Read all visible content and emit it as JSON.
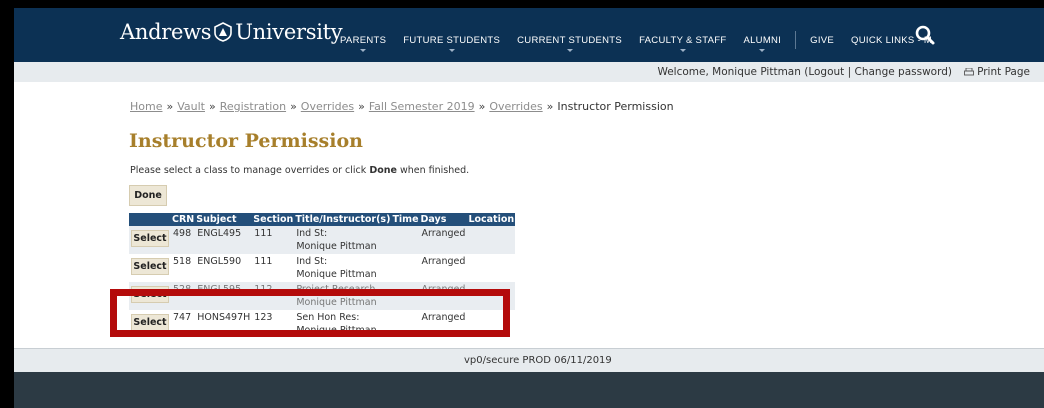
{
  "header": {
    "logo_left": "Andrews",
    "logo_right": "University",
    "nav": [
      {
        "label": "PARENTS",
        "caret": true
      },
      {
        "label": "FUTURE STUDENTS",
        "caret": true
      },
      {
        "label": "CURRENT STUDENTS",
        "caret": true
      },
      {
        "label": "FACULTY & STAFF",
        "caret": true
      },
      {
        "label": "ALUMNI",
        "caret": true
      },
      {
        "label": "GIVE",
        "caret": false
      },
      {
        "label": "QUICK LINKS - M",
        "caret": false
      }
    ],
    "search_icon": "search-icon",
    "colors": {
      "nav_bg": "#0c3154",
      "accent": "#a77f2b"
    }
  },
  "subbar": {
    "welcome_prefix": "Welcome, Monique Pittman (",
    "logout": "Logout",
    "divider": " | ",
    "change_password": "Change password",
    "welcome_suffix": ")",
    "print_page": "Print Page"
  },
  "breadcrumb": {
    "links": [
      "Home",
      "Vault",
      "Registration",
      "Overrides",
      "Fall Semester 2019",
      "Overrides"
    ],
    "separator": "»",
    "current": "Instructor Permission"
  },
  "page": {
    "title": "Instructor Permission",
    "instructions_before": "Please select a class to manage overrides or click ",
    "instructions_bold": "Done",
    "instructions_after": " when finished.",
    "done_label": "Done"
  },
  "table": {
    "headers": [
      "",
      "CRN",
      "Subject",
      "Section",
      "Title/Instructor(s)",
      "Time",
      "Days",
      "Location"
    ],
    "select_label": "Select",
    "rows": [
      {
        "crn": "498",
        "subject": "ENGL495",
        "section": "111",
        "title": "Ind St:",
        "instructor": "Monique Pittman",
        "time": "",
        "days": "Arranged",
        "location": ""
      },
      {
        "crn": "518",
        "subject": "ENGL590",
        "section": "111",
        "title": "Ind St:",
        "instructor": "Monique Pittman",
        "time": "",
        "days": "Arranged",
        "location": ""
      },
      {
        "crn": "528",
        "subject": "ENGL595",
        "section": "112",
        "title": "Project Research",
        "instructor": "Monique Pittman",
        "time": "",
        "days": "Arranged",
        "location": ""
      },
      {
        "crn": "747",
        "subject": "HONS497H",
        "section": "123",
        "title": "Sen Hon Res:",
        "instructor": "Monique Pittman",
        "time": "",
        "days": "Arranged",
        "location": ""
      }
    ]
  },
  "footer": {
    "text": "vp0/secure PROD 06/11/2019"
  }
}
